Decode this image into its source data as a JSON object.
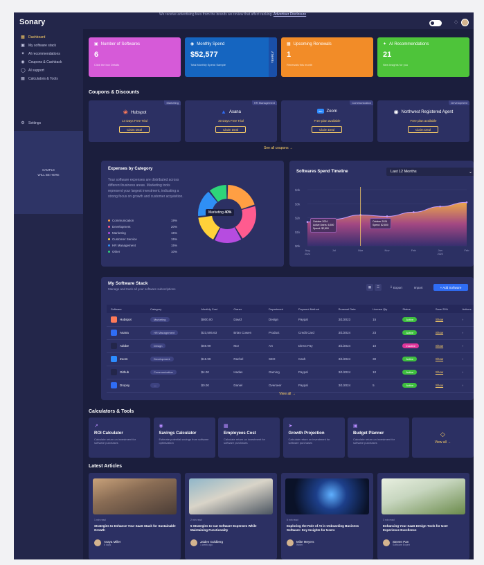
{
  "app": {
    "title": "Sonary"
  },
  "notice": {
    "text": "We receive advertising fees from the brands we review that affect ranking.",
    "link": "Advertiser Disclosure"
  },
  "sidebar": {
    "items": [
      {
        "label": "Dashboard",
        "icon": "dashboard-icon"
      },
      {
        "label": "My software stack",
        "icon": "stack-icon"
      },
      {
        "label": "AI recommendations",
        "icon": "sparkle-icon"
      },
      {
        "label": "Coupons & Cashback",
        "icon": "coupon-icon"
      },
      {
        "label": "AI support",
        "icon": "support-icon"
      },
      {
        "label": "Calculators & Tools",
        "icon": "calculator-icon"
      }
    ],
    "settings": "Settings",
    "ad": "SAMPLE\nWILL BE HERE"
  },
  "stats": [
    {
      "title": "Number of Softwares",
      "value": "6",
      "sub": "Click the box Details",
      "color": "#d65ad8"
    },
    {
      "title": "Monthly Spend",
      "value": "$52,577",
      "sub": "Total Monthly Spend Sample",
      "color": "#1565c0",
      "tab": "YEARLY"
    },
    {
      "title": "Upcoming Renewals",
      "value": "1",
      "sub": "Renewals this month",
      "color": "#f28c28"
    },
    {
      "title": "AI Recommendations",
      "value": "21",
      "sub": "New insights for you",
      "color": "#4ec43a"
    }
  ],
  "coupons": {
    "title": "Coupons & Discounts",
    "items": [
      {
        "name": "Hubspot",
        "offer": "14 Days Free Trial",
        "badge": "Marketing",
        "button": "Claim Deal"
      },
      {
        "name": "Asana",
        "offer": "30 Days Free Trial",
        "badge": "HR Management",
        "button": "Claim Deal"
      },
      {
        "name": "Zoom",
        "offer": "Free plan available",
        "badge": "Communication",
        "button": "Claim Deal"
      },
      {
        "name": "Northwest Registered Agent",
        "offer": "Free plan available",
        "badge": "Development",
        "button": "Claim Deal"
      }
    ],
    "see_all": "See all coupons →"
  },
  "expenses": {
    "title": "Expenses by Category",
    "description": "Your software expenses are distributed across different business areas. Marketing tools represent your largest investment, indicating a strong focus on growth and customer acquisition.",
    "donut_label": "Marketing",
    "donut_pct": "40%",
    "legend": [
      {
        "name": "Communication",
        "pct": "19%",
        "color": "#ff9f43"
      },
      {
        "name": "Development",
        "pct": "20%",
        "color": "#ff5b8f"
      },
      {
        "name": "Marketing",
        "pct": "15%",
        "color": "#b64ce0"
      },
      {
        "name": "Customer Service",
        "pct": "15%",
        "color": "#ffd13a"
      },
      {
        "name": "HR Management",
        "pct": "15%",
        "color": "#2f8ff5"
      },
      {
        "name": "Other",
        "pct": "10%",
        "color": "#2ed47a"
      }
    ]
  },
  "timeline": {
    "title": "Softwares Spend Timeline",
    "range": "Last 12 Months"
  },
  "chart_data": [
    {
      "type": "pie",
      "title": "Expenses by Category",
      "categories": [
        "Communication",
        "Development",
        "Marketing",
        "Customer Service",
        "HR Management",
        "Other"
      ],
      "values": [
        19,
        20,
        15,
        15,
        15,
        10
      ]
    },
    {
      "type": "area",
      "title": "Softwares Spend Timeline",
      "x": [
        "Aug",
        "Jul",
        "Mar",
        "Nov",
        "Feb",
        "Jun",
        "Feb"
      ],
      "x_sub": [
        "2024",
        "",
        "",
        "",
        "",
        "2025",
        ""
      ],
      "y_ticks": [
        "$4k",
        "$3k",
        "$2k",
        "$1k",
        "$0k"
      ],
      "values": [
        1.7,
        1.9,
        2.2,
        2.1,
        2.4,
        2.8,
        3.1
      ],
      "tooltips": [
        {
          "lines": [
            "October 2024",
            "Active Users: 6,500",
            "Spend: $2,800"
          ]
        },
        {
          "lines": [
            "October 2024",
            "Spend: $2,800"
          ]
        }
      ]
    }
  ],
  "stack": {
    "title": "My Software Stack",
    "subtitle": "Manage and track all your software subscriptions",
    "buttons": {
      "export": "Export",
      "import": "Import",
      "add": "+ Add Software"
    },
    "columns": [
      "Software",
      "Category",
      "Monthly Cost",
      "Owner",
      "Department",
      "Payment Method",
      "Renewal Date",
      "License Qty",
      "Status",
      "Save 20%",
      "Actions"
    ],
    "rows": [
      {
        "name": "Hubspot",
        "category": "Marketing",
        "cost": "$800.00",
        "owner": "David",
        "dept": "Design",
        "payment": "Paypal",
        "renewal": "3/1/2023",
        "qty": "15",
        "status": "Active",
        "save": "Show",
        "icon_color": "#ff7a59"
      },
      {
        "name": "Asana",
        "category": "HR Management",
        "cost": "$23,506.63",
        "owner": "Brian Cowen",
        "dept": "Product",
        "payment": "Credit Card",
        "renewal": "3/1/2024",
        "qty": "23",
        "status": "Active",
        "save": "Show",
        "icon_color": "#2f6df5"
      },
      {
        "name": "Adobe",
        "category": "Design",
        "cost": "$59.99",
        "owner": "Mor",
        "dept": "Art",
        "payment": "Direct Pay",
        "renewal": "3/1/2024",
        "qty": "10",
        "status": "Inactive",
        "save": "Show",
        "icon_color": "#23264a"
      },
      {
        "name": "Zoom",
        "category": "Development",
        "cost": "$15.99",
        "owner": "Rachel",
        "dept": "SEO",
        "payment": "Cash",
        "renewal": "3/1/2024",
        "qty": "30",
        "status": "Active",
        "save": "Show",
        "icon_color": "#2d8cff"
      },
      {
        "name": "Github",
        "category": "Communication",
        "cost": "$4.00",
        "owner": "Hadas",
        "dept": "Gaming",
        "payment": "Paypal",
        "renewal": "3/1/2024",
        "qty": "10",
        "status": "Active",
        "save": "Show",
        "icon_color": "#23264a"
      },
      {
        "name": "Dropsy",
        "category": "—",
        "cost": "$0.00",
        "owner": "Daniel",
        "dept": "Overseer",
        "payment": "Paypal",
        "renewal": "3/1/2024",
        "qty": "5",
        "status": "Active",
        "save": "Show",
        "icon_color": "#2f6df5"
      }
    ],
    "view_all": "View all →"
  },
  "calculators": {
    "title": "Calculators & Tools",
    "items": [
      {
        "name": "ROI Calculator",
        "desc": "Calculate return on investment for software purchases",
        "icon": "chart-icon"
      },
      {
        "name": "Savings Calculator",
        "desc": "Estimate potential savings from software optimization",
        "icon": "dollar-icon"
      },
      {
        "name": "Employees Cost",
        "desc": "Calculate return on investment for software purchases",
        "icon": "bars-icon"
      },
      {
        "name": "Growth Projection",
        "desc": "Calculate return on investment for software purchases",
        "icon": "rocket-icon"
      },
      {
        "name": "Budget Planner",
        "desc": "Calculate return on investment for software purchases",
        "icon": "planner-icon"
      }
    ],
    "view_all": "View all →"
  },
  "articles": {
    "title": "Latest Articles",
    "items": [
      {
        "date": "1 min read",
        "title": "Strategies to Enhance Your SaaS Stack for Sustainable Growth",
        "author": "Avaya Miller",
        "role": "6 days"
      },
      {
        "date": "2 min read",
        "title": "5 Strategies to Cut Software Expenses While Maintaining Functionality",
        "author": "Jaiden Goldberg",
        "role": "1 week ago"
      },
      {
        "date": "6 min read",
        "title": "Exploring the Role of AI in Onboarding Business Software: Key Insights for Users",
        "author": "Mike Meyers",
        "role": "Writer"
      },
      {
        "date": "3 min read",
        "title": "Enhancing Your SaaS Design Tools for User Experience Excellence",
        "author": "Steven Pan",
        "role": "Software Expert"
      }
    ]
  }
}
